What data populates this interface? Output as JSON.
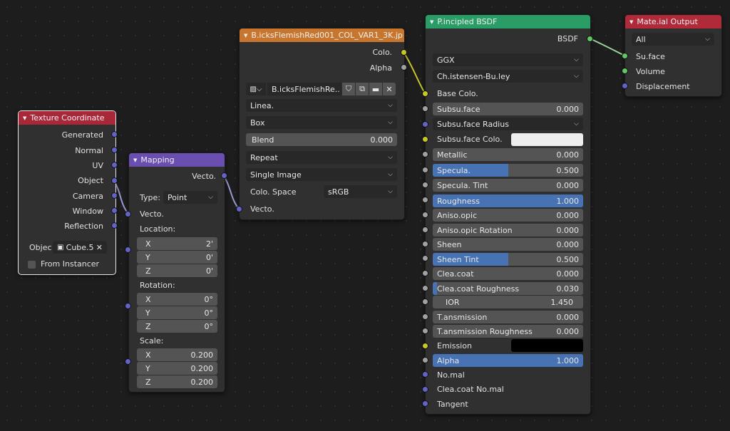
{
  "colors": {
    "canvas_bg": "#1d1d1d",
    "node_bg": "#303030",
    "texture_coord_header": "#a8283a",
    "mapping_header": "#6b4fb0",
    "image_texture_header": "#c8762e",
    "principled_header": "#2a9d67",
    "output_header": "#b02a3a",
    "socket_vector": "#6363c7",
    "socket_color": "#c7c729",
    "socket_float": "#a1a1a1",
    "socket_shader": "#63c763",
    "slider_fill": "#4772b3",
    "subsurface_color": "#eeeeee",
    "emission_color": "#000000"
  },
  "texcoord": {
    "title": "Texture Coordinate",
    "outputs": [
      "Generated",
      "Normal",
      "UV",
      "Object",
      "Camera",
      "Window",
      "Reflection"
    ],
    "object_label": "Objec",
    "object_value": "Cube.5",
    "from_instancer": "From Instancer"
  },
  "mapping": {
    "title": "Mapping",
    "output": "Vecto.",
    "type_label": "Type:",
    "type_value": "Point",
    "input_vector": "Vecto.",
    "location_label": "Location:",
    "location": [
      {
        "axis": "X",
        "value": "2'"
      },
      {
        "axis": "Y",
        "value": "0'"
      },
      {
        "axis": "Z",
        "value": "0'"
      }
    ],
    "rotation_label": "Rotation:",
    "rotation": [
      {
        "axis": "X",
        "value": "0°"
      },
      {
        "axis": "Y",
        "value": "0°"
      },
      {
        "axis": "Z",
        "value": "0°"
      }
    ],
    "scale_label": "Scale:",
    "scale": [
      {
        "axis": "X",
        "value": "0.200"
      },
      {
        "axis": "Y",
        "value": "0.200"
      },
      {
        "axis": "Z",
        "value": "0.200"
      }
    ]
  },
  "image": {
    "title": "B.icksFlemishRed001_COL_VAR1_3K.jp",
    "output_color": "Colo.",
    "output_alpha": "Alpha",
    "image_name": "B.icksFlemishRe..",
    "interpolation": "Linea.",
    "projection": "Box",
    "blend_label": "Blend",
    "blend_value": "0.000",
    "extension": "Repeat",
    "source": "Single Image",
    "colorspace_label": "Colo. Space",
    "colorspace_value": "sRGB",
    "input_vector": "Vecto."
  },
  "principled": {
    "title": "P.incipled BSDF",
    "output": "BSDF",
    "distribution": "GGX",
    "subsurface_method": "Ch.istensen-Bu.ley",
    "base_color": "Base Colo.",
    "subsurface_label": "Subsu.face",
    "subsurface_value": "0.000",
    "subsurface_radius": "Subsu.face Radius",
    "subsurface_color": "Subsu.face Colo.",
    "metallic_label": "Metallic",
    "metallic_value": "0.000",
    "specular_label": "Specula.",
    "specular_value": "0.500",
    "specular_tint_label": "Specula. Tint",
    "specular_tint_value": "0.000",
    "roughness_label": "Roughness",
    "roughness_value": "1.000",
    "anisotropic_label": "Aniso.opic",
    "anisotropic_value": "0.000",
    "anisotropic_rotation_label": "Aniso.opic Rotation",
    "anisotropic_rotation_value": "0.000",
    "sheen_label": "Sheen",
    "sheen_value": "0.000",
    "sheen_tint_label": "Sheen Tint",
    "sheen_tint_value": "0.500",
    "clearcoat_label": "Clea.coat",
    "clearcoat_value": "0.000",
    "clearcoat_roughness_label": "Clea.coat Roughness",
    "clearcoat_roughness_value": "0.030",
    "ior_label": "IOR",
    "ior_value": "1.450",
    "transmission_label": "T.ansmission",
    "transmission_value": "0.000",
    "transmission_roughness_label": "T.ansmission Roughness",
    "transmission_roughness_value": "0.000",
    "emission_label": "Emission",
    "alpha_label": "Alpha",
    "alpha_value": "1.000",
    "normal_label": "No.mal",
    "clearcoat_normal_label": "Clea.coat No.mal",
    "tangent_label": "Tangent"
  },
  "output": {
    "title": "Mate.ial Output",
    "target": "All",
    "surface": "Su.face",
    "volume": "Volume",
    "displacement": "Displacement"
  }
}
